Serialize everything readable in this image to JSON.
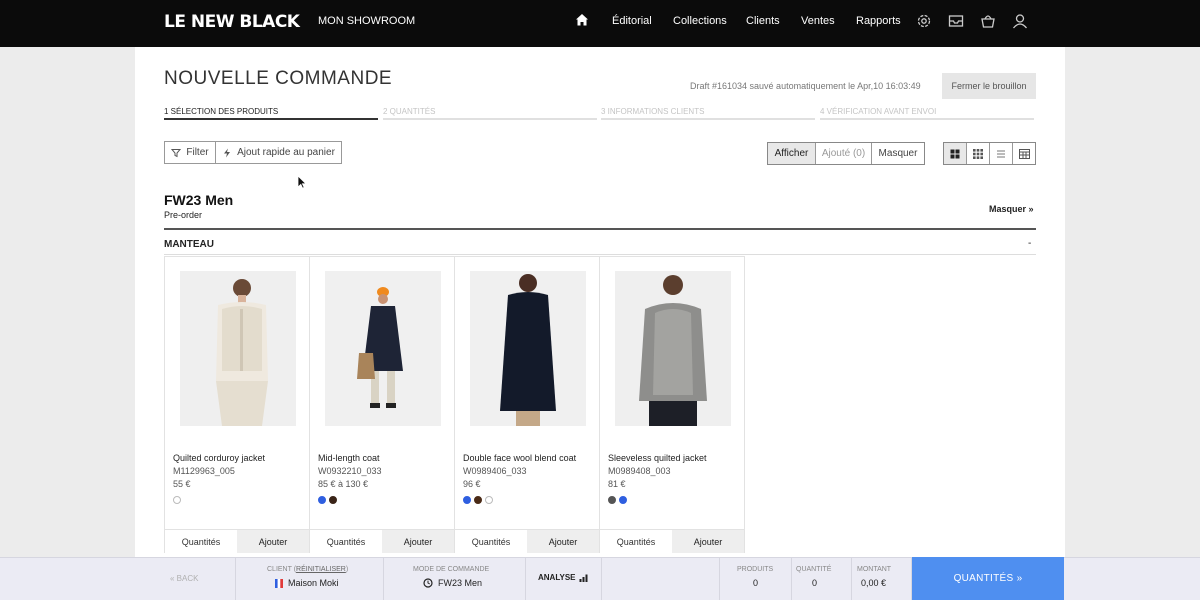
{
  "brand": {
    "logo": "LE NEW BLACK",
    "showroom": "MON SHOWROOM"
  },
  "nav": {
    "links": [
      "Éditorial",
      "Collections",
      "Clients",
      "Ventes",
      "Rapports"
    ],
    "icons": [
      "home-icon",
      "gear-icon",
      "inbox-icon",
      "basket-icon",
      "user-icon"
    ]
  },
  "page": {
    "title": "NOUVELLE COMMANDE",
    "draft_status": "Draft #161034 sauvé automatiquement le Apr,10 16:03:49",
    "close_draft": "Fermer le brouillon"
  },
  "steps": [
    {
      "label": "1 SÉLECTION DES PRODUITS",
      "active": true
    },
    {
      "label": "2 QUANTITÉS",
      "active": false
    },
    {
      "label": "3 INFORMATIONS CLIENTS",
      "active": false
    },
    {
      "label": "4 VÉRIFICATION AVANT ENVOI",
      "active": false
    }
  ],
  "toolbar": {
    "filter": "Filter",
    "quick_add": "Ajout rapide au panier",
    "show": "Afficher",
    "added": "Ajouté (0)",
    "hide": "Masquer",
    "view_modes": [
      "grid-large-icon",
      "grid-small-icon",
      "list-icon",
      "table-icon"
    ]
  },
  "season": {
    "title": "FW23 Men",
    "subtitle": "Pre-order",
    "hide_link": "Masquer »",
    "category": "MANTEAU",
    "collapse": "-"
  },
  "products": [
    {
      "name": "Quilted corduroy jacket",
      "ref": "M1129963_005",
      "price": "55 €",
      "swatches": [
        "#ffffff"
      ],
      "actions": [
        "Quantités",
        "Ajouter"
      ]
    },
    {
      "name": "Mid-length coat",
      "ref": "W0932210_033",
      "price": "85 € à 130 €",
      "swatches": [
        "#2f5fe0",
        "#3a2418"
      ],
      "actions": [
        "Quantités",
        "Ajouter"
      ]
    },
    {
      "name": "Double face wool blend coat",
      "ref": "W0989406_033",
      "price": "96 €",
      "swatches": [
        "#2f5fe0",
        "#4a2a16",
        "#ffffff"
      ],
      "actions": [
        "Quantités",
        "Ajouter"
      ]
    },
    {
      "name": "Sleeveless quilted jacket",
      "ref": "M0989408_003",
      "price": "81 €",
      "swatches": [
        "#555555",
        "#2f5fe0"
      ],
      "actions": [
        "Quantités",
        "Ajouter"
      ]
    }
  ],
  "bottom": {
    "back": "« BACK",
    "client_label": "CLIENT (",
    "client_reset": "RÉINITIALISER",
    "client_label_end": ")",
    "client_name": "Maison Moki",
    "mode_label": "MODE DE COMMANDE",
    "mode_value": "FW23 Men",
    "analyse": "ANALYSE",
    "products_label": "PRODUITS",
    "products_value": "0",
    "quantity_label": "QUANTITÉ",
    "quantity_value": "0",
    "amount_label": "MONTANT",
    "amount_value": "0,00 €",
    "cta": "QUANTITÉS »"
  },
  "colors": {
    "accent": "#4f8ff0",
    "topbar": "#0b0b0b",
    "bottombar": "#ebebf4"
  }
}
